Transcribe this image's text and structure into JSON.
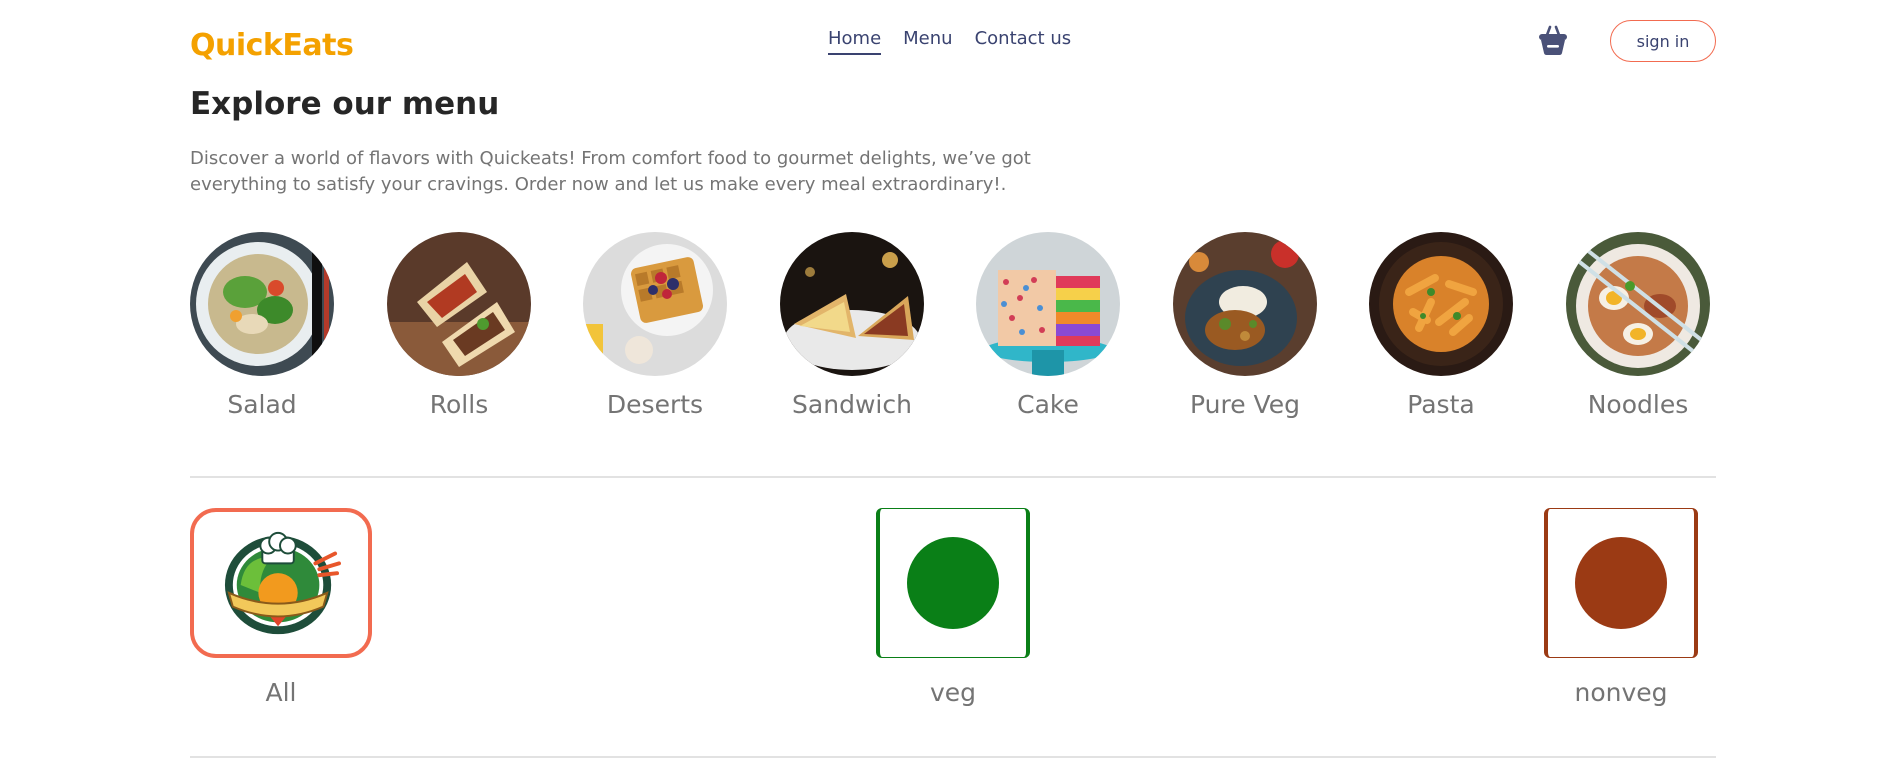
{
  "brand": {
    "name": "QuickEats",
    "color": "#f4a100"
  },
  "nav": {
    "links": [
      {
        "label": "Home",
        "active": true
      },
      {
        "label": "Menu",
        "active": false
      },
      {
        "label": "Contact us",
        "active": false
      }
    ],
    "basket_icon": "basket-icon",
    "signin_label": "sign in"
  },
  "hero": {
    "title": "Explore our menu",
    "description": "Discover a world of flavors with Quickeats! From comfort food to gourmet delights, we’ve got everything to satisfy your cravings. Order now and let us make every meal extraordinary!."
  },
  "categories": [
    {
      "label": "Salad"
    },
    {
      "label": "Rolls"
    },
    {
      "label": "Deserts"
    },
    {
      "label": "Sandwich"
    },
    {
      "label": "Cake"
    },
    {
      "label": "Pure Veg"
    },
    {
      "label": "Pasta"
    },
    {
      "label": "Noodles"
    }
  ],
  "filters": [
    {
      "label": "All",
      "selected": true
    },
    {
      "label": "veg",
      "color": "#0a7f17"
    },
    {
      "label": "nonveg",
      "color": "#9b3a14"
    }
  ],
  "colors": {
    "accent": "#f26b50",
    "nav_text": "#3a4370",
    "muted_text": "#747474"
  }
}
